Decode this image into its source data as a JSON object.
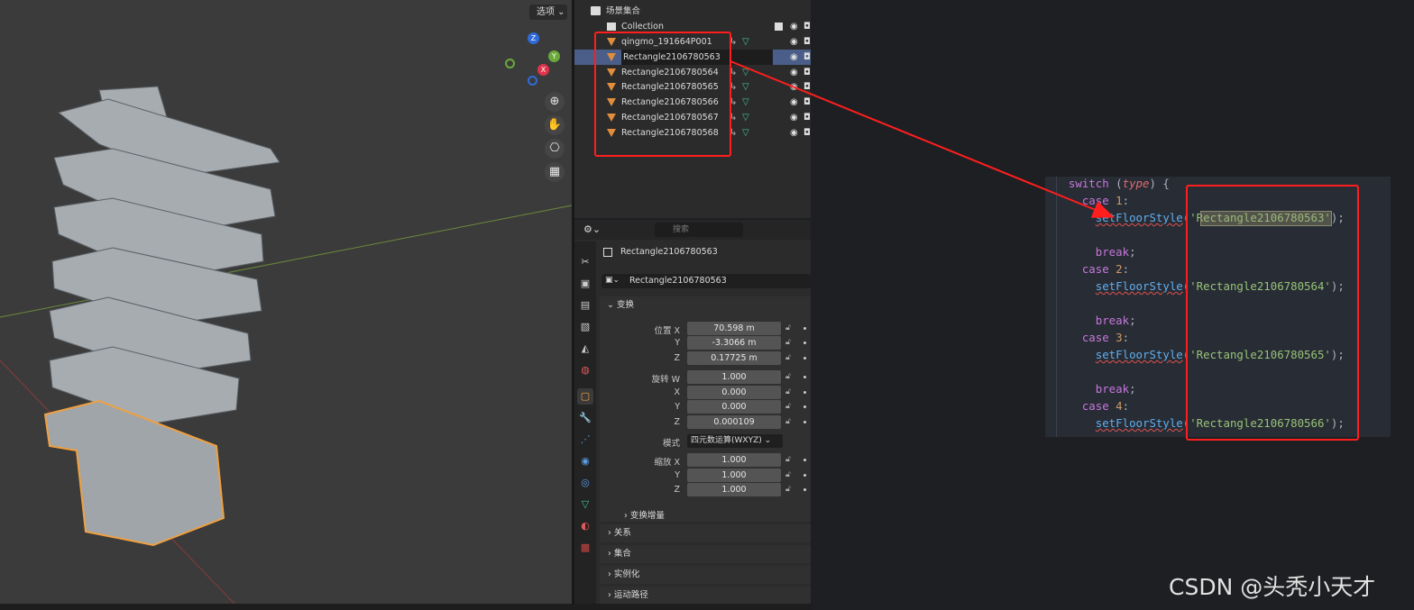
{
  "viewport": {
    "options_label": "选项",
    "gizmo_axes": {
      "z": "Z",
      "y": "Y",
      "x": "X"
    }
  },
  "outliner": {
    "root": "场景集合",
    "collection": "Collection",
    "items": [
      {
        "name": "qingmo_191664P001",
        "selected": false
      },
      {
        "name": "Rectangle2106780563",
        "selected": true
      },
      {
        "name": "Rectangle2106780564",
        "selected": false
      },
      {
        "name": "Rectangle2106780565",
        "selected": false
      },
      {
        "name": "Rectangle2106780566",
        "selected": false
      },
      {
        "name": "Rectangle2106780567",
        "selected": false
      },
      {
        "name": "Rectangle2106780568",
        "selected": false
      }
    ]
  },
  "properties": {
    "search_placeholder": "搜索",
    "object_name": "Rectangle2106780563",
    "data_name": "Rectangle2106780563",
    "transform_header": "变换",
    "location_label": "位置 X",
    "location": {
      "x": "70.598 m",
      "y": "-3.3066 m",
      "z": "0.17725 m"
    },
    "rotation_label": "旋转 W",
    "rotation": {
      "w": "1.000",
      "x": "0.000",
      "y": "0.000",
      "z": "0.000109"
    },
    "mode_label": "模式",
    "mode_value": "四元数运算(WXYZ)",
    "scale_label": "缩放 X",
    "scale": {
      "x": "1.000",
      "y": "1.000",
      "z": "1.000"
    },
    "axis_labels": {
      "x": "X",
      "y": "Y",
      "z": "Z"
    },
    "delta_transform": "变换增量",
    "sections": [
      "关系",
      "集合",
      "实例化",
      "运动路径"
    ]
  },
  "code": {
    "lines": [
      {
        "indent": "  ",
        "parts": [
          [
            "kw",
            "switch"
          ],
          [
            "p",
            " ("
          ],
          [
            "ital",
            "type"
          ],
          [
            "p",
            ") {"
          ]
        ]
      },
      {
        "indent": "    ",
        "parts": [
          [
            "kw",
            "case"
          ],
          [
            "p",
            " "
          ],
          [
            "num",
            "1"
          ],
          [
            "p",
            ":"
          ]
        ]
      },
      {
        "indent": "      ",
        "parts": [
          [
            "fn",
            "setFloorStyle"
          ],
          [
            "p",
            "("
          ],
          [
            "str",
            "'Rectangle2106780563'"
          ],
          [
            "p",
            ");"
          ]
        ]
      },
      {
        "indent": "",
        "parts": []
      },
      {
        "indent": "      ",
        "parts": [
          [
            "kw",
            "break"
          ],
          [
            "p",
            ";"
          ]
        ]
      },
      {
        "indent": "    ",
        "parts": [
          [
            "kw",
            "case"
          ],
          [
            "p",
            " "
          ],
          [
            "num",
            "2"
          ],
          [
            "p",
            ":"
          ]
        ]
      },
      {
        "indent": "      ",
        "parts": [
          [
            "fn",
            "setFloorStyle"
          ],
          [
            "p",
            "("
          ],
          [
            "str",
            "'Rectangle2106780564'"
          ],
          [
            "p",
            ");"
          ]
        ]
      },
      {
        "indent": "",
        "parts": []
      },
      {
        "indent": "      ",
        "parts": [
          [
            "kw",
            "break"
          ],
          [
            "p",
            ";"
          ]
        ]
      },
      {
        "indent": "    ",
        "parts": [
          [
            "kw",
            "case"
          ],
          [
            "p",
            " "
          ],
          [
            "num",
            "3"
          ],
          [
            "p",
            ":"
          ]
        ]
      },
      {
        "indent": "      ",
        "parts": [
          [
            "fn",
            "setFloorStyle"
          ],
          [
            "p",
            "("
          ],
          [
            "str",
            "'Rectangle2106780565'"
          ],
          [
            "p",
            ");"
          ]
        ]
      },
      {
        "indent": "",
        "parts": []
      },
      {
        "indent": "      ",
        "parts": [
          [
            "kw",
            "break"
          ],
          [
            "p",
            ";"
          ]
        ]
      },
      {
        "indent": "    ",
        "parts": [
          [
            "kw",
            "case"
          ],
          [
            "p",
            " "
          ],
          [
            "num",
            "4"
          ],
          [
            "p",
            ":"
          ]
        ]
      },
      {
        "indent": "      ",
        "parts": [
          [
            "fn",
            "setFloorStyle"
          ],
          [
            "p",
            "("
          ],
          [
            "str",
            "'Rectangle2106780566'"
          ],
          [
            "p",
            ");"
          ]
        ]
      }
    ]
  },
  "watermark": "CSDN @头秃小天才",
  "colors": {
    "annotation_red": "#ff1e1e",
    "selection_blue": "#4a5e89",
    "object_orange": "#e08d3c"
  }
}
